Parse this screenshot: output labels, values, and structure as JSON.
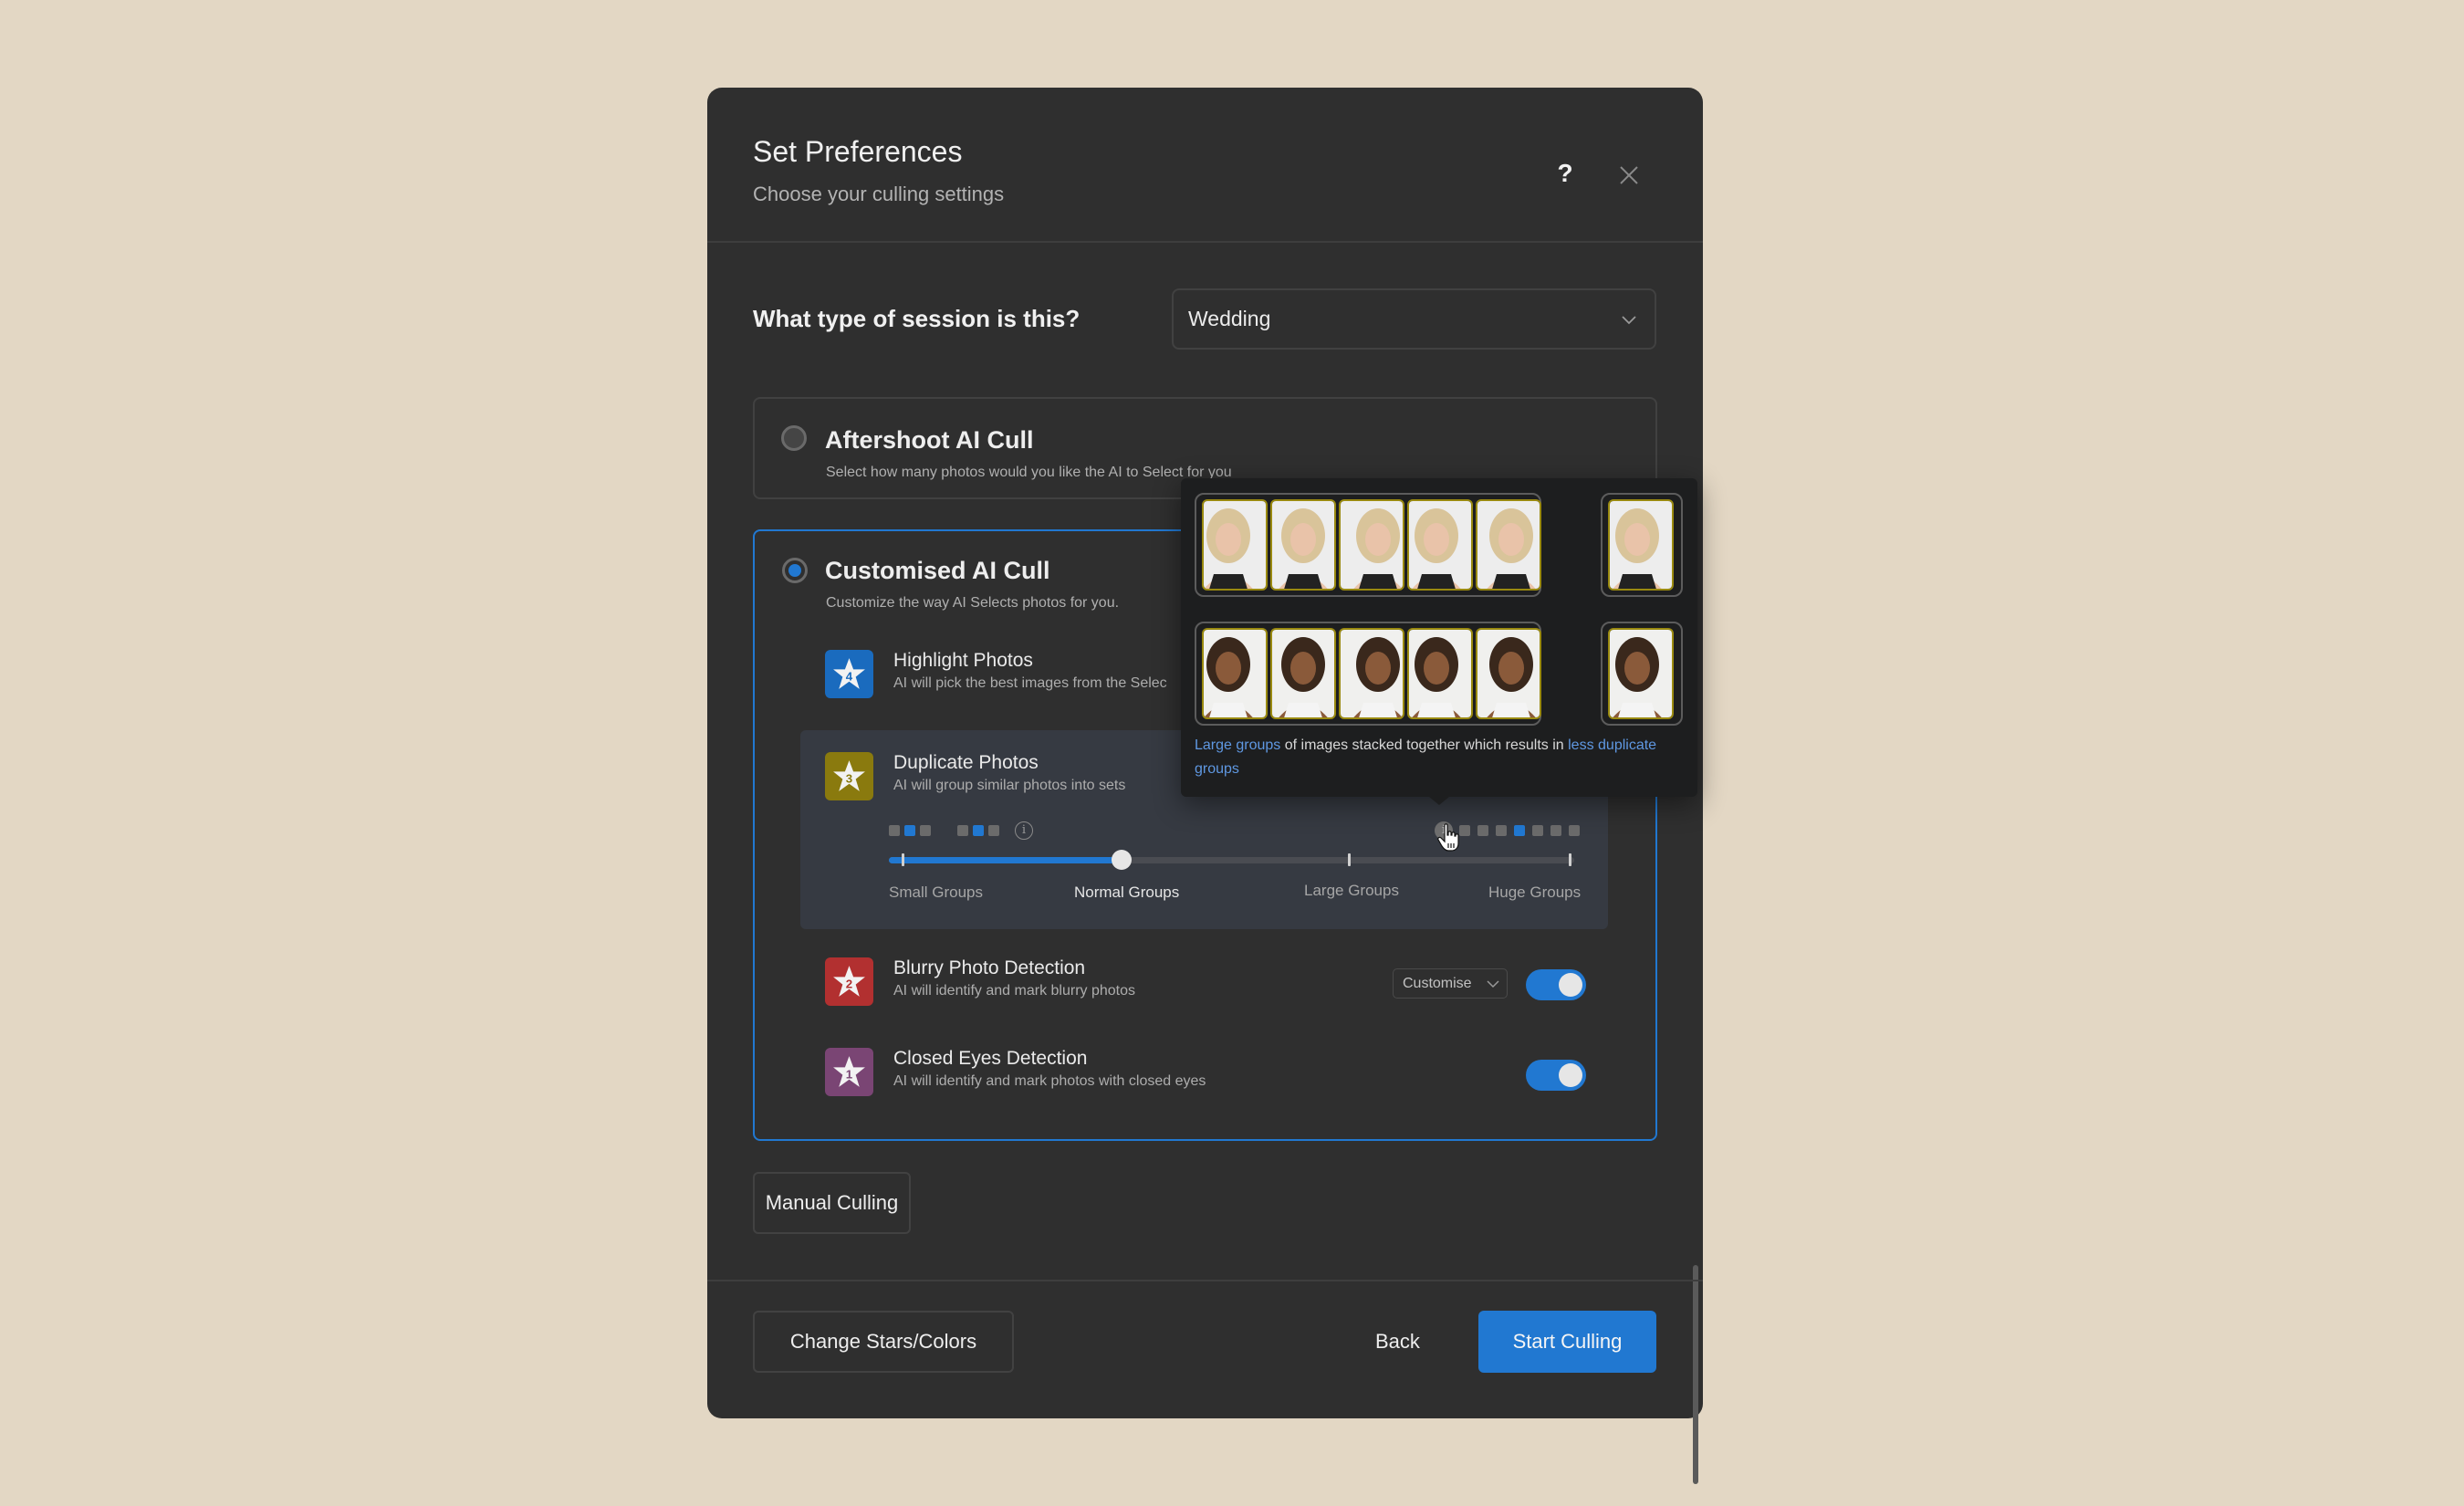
{
  "dialog": {
    "title": "Set Preferences",
    "subtitle": "Choose your culling settings",
    "help_icon": "question-mark-icon",
    "close_icon": "close-x-icon"
  },
  "session": {
    "label": "What type of session is this?",
    "selected": "Wedding",
    "icon": "chevron-down-icon"
  },
  "options": {
    "aftershoot": {
      "title": "Aftershoot AI Cull",
      "description": "Select how many photos would you like the AI to Select for you",
      "selected": false
    },
    "customised": {
      "title": "Customised AI Cull",
      "description": "Customize the way AI Selects photos for you.",
      "selected": true
    }
  },
  "features": [
    {
      "title": "Highlight Photos",
      "description": "AI will pick the best images from the Selec",
      "star": "4",
      "color": "#1a6bbe",
      "icon": "star-icon"
    },
    {
      "title": "Duplicate Photos",
      "description": "AI will group similar photos into sets",
      "star": "3",
      "color": "#8a7a0e",
      "icon": "star-icon"
    },
    {
      "title": "Blurry Photo Detection",
      "description": "AI will identify and mark blurry photos",
      "star": "2",
      "color": "#b23030",
      "icon": "star-icon",
      "dropdown": "Customise",
      "enabled": true
    },
    {
      "title": "Closed Eyes Detection",
      "description": "AI will identify and mark photos with closed eyes",
      "star": "1",
      "color": "#7a4574",
      "icon": "star-icon",
      "enabled": true
    }
  ],
  "grouping_slider": {
    "labels": [
      "Small Groups",
      "Normal Groups",
      "Large Groups",
      "Huge Groups"
    ],
    "selected_index": 1,
    "value_fraction": 0.34,
    "left_legend": {
      "group_a": [
        false,
        true,
        false
      ],
      "group_b": [
        false,
        true,
        false
      ]
    },
    "right_legend": [
      false,
      false,
      false,
      true,
      false,
      false,
      false
    ],
    "info_icon": "info-icon"
  },
  "tooltip": {
    "highlight_1": "Large groups",
    "text": " of images stacked together which results in ",
    "highlight_2": "less duplicate groups",
    "rows": [
      {
        "group_size": 5,
        "single_size": 1,
        "subject": "blonde-woman-portrait"
      },
      {
        "group_size": 5,
        "single_size": 1,
        "subject": "curly-hair-woman-portrait"
      }
    ]
  },
  "buttons": {
    "manual_culling": "Manual Culling",
    "change_stars": "Change Stars/Colors",
    "back": "Back",
    "start": "Start Culling"
  }
}
